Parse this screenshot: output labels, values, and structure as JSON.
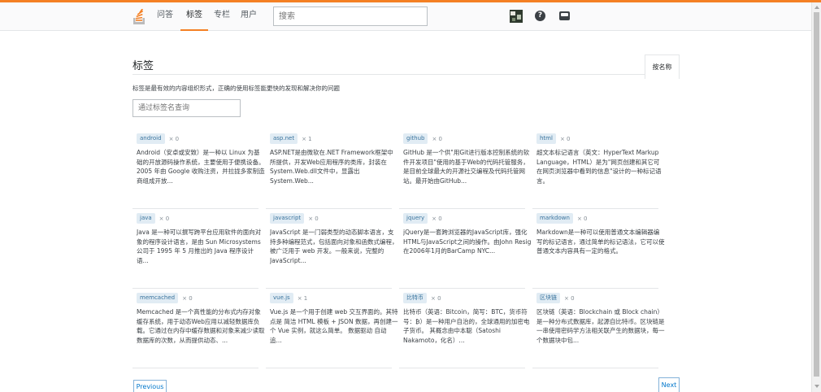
{
  "header": {
    "nav": [
      {
        "label": "问答",
        "active": false
      },
      {
        "label": "标签",
        "active": true
      },
      {
        "label": "专栏",
        "active": false
      },
      {
        "label": "用户",
        "active": false
      }
    ],
    "search_placeholder": "搜索",
    "help_icon": "?",
    "colors": {
      "accent": "#f48024",
      "tag_bg": "#e1ecf4",
      "tag_text": "#39739d",
      "link": "#0077cc"
    }
  },
  "page": {
    "title": "标签",
    "sort_tab": "按名称",
    "subtitle": "标签是最有效的内容组织形式，正确的使用标签能更快的发现和解决你的问题",
    "filter_placeholder": "通过标签名查询"
  },
  "tags": [
    {
      "name": "android",
      "count": "× 0",
      "excerpt": "Android（安卓或安致）是一种以 Linux 为基础的开放源码操作系统，主要使用于便携设备。2005 年由 Google 收购注资，并拉拢多家制造商组成开放..."
    },
    {
      "name": "asp.net",
      "count": "× 1",
      "excerpt": "ASP.NET是由微软在.NET Framework框架中所提供，开发Web应用程序的类库，封装在System.Web.dll文件中，显露出System.Web..."
    },
    {
      "name": "github",
      "count": "× 0",
      "excerpt": "GitHub 是一个供\"用Git进行版本控制系统的软件开发项目\"使用的基于Web的代码托管服务，是目前全球最大的开源社交编程及代码托管网站。最开始由GitHub..."
    },
    {
      "name": "html",
      "count": "× 0",
      "excerpt": "超文本标记语言（英文：HyperText Markup Language，HTML）是为\"网页创建和其它可在网页浏览器中看到的信息\"设计的一种标记语言。"
    },
    {
      "name": "java",
      "count": "× 0",
      "excerpt": "Java 是一种可以撰写跨平台应用软件的面向对象的程序设计语言，是由 Sun Microsystems 公司于 1995 年 5 月推出的 Java 程序设计语..."
    },
    {
      "name": "javascript",
      "count": "× 0",
      "excerpt": "JavaScript 是一门弱类型的动态脚本语言，支持多种编程范式，包括面向对象和函数式编程，被广泛用于 web 开发。一般来说，完整的JavaScript..."
    },
    {
      "name": "jquery",
      "count": "× 0",
      "excerpt": "jQuery是一套跨浏览器的JavaScript库，强化HTML与JavaScript之间的操作。由John Resig在2006年1月的BarCamp NYC..."
    },
    {
      "name": "markdown",
      "count": "× 0",
      "excerpt": "Markdown是一种可以使用普通文本编辑器编写的标记语言，通过简单的标记语法，它可以使普通文本内容具有一定的格式。"
    },
    {
      "name": "memcached",
      "count": "× 0",
      "excerpt": "Memcached 是一个高性能的分布式内存对象缓存系统，用于动态Web应用以减轻数据库负载。它通过在内存中缓存数据和对象来减少读取数据库的次数，从而提供动态、..."
    },
    {
      "name": "vue.js",
      "count": "× 1",
      "excerpt": "Vue.js 是一个用于创建 web 交互界面的。其特点是 简洁 HTML 模板 + JSON 数据，再创建一个 Vue 实例，就这么简单。 数据驱动 自动追..."
    },
    {
      "name": "比特币",
      "count": "× 0",
      "excerpt": "比特币（英语：Bitcoin，简写：BTC，货币符号：₿）是一种用户自治的，全球通用的加密电子货币。 其概念由中本聪（Satoshi Nakamoto，化名）..."
    },
    {
      "name": "区块链",
      "count": "× 0",
      "excerpt": "区块链（英语：Blockchain 或 Block chain）是一种分布式数据库，起源自比特币。区块链是一串使用密码学方法相关联产生的数据块，每一个数据块中包..."
    }
  ],
  "pagination": {
    "prev": "Previous",
    "next": "Next"
  }
}
